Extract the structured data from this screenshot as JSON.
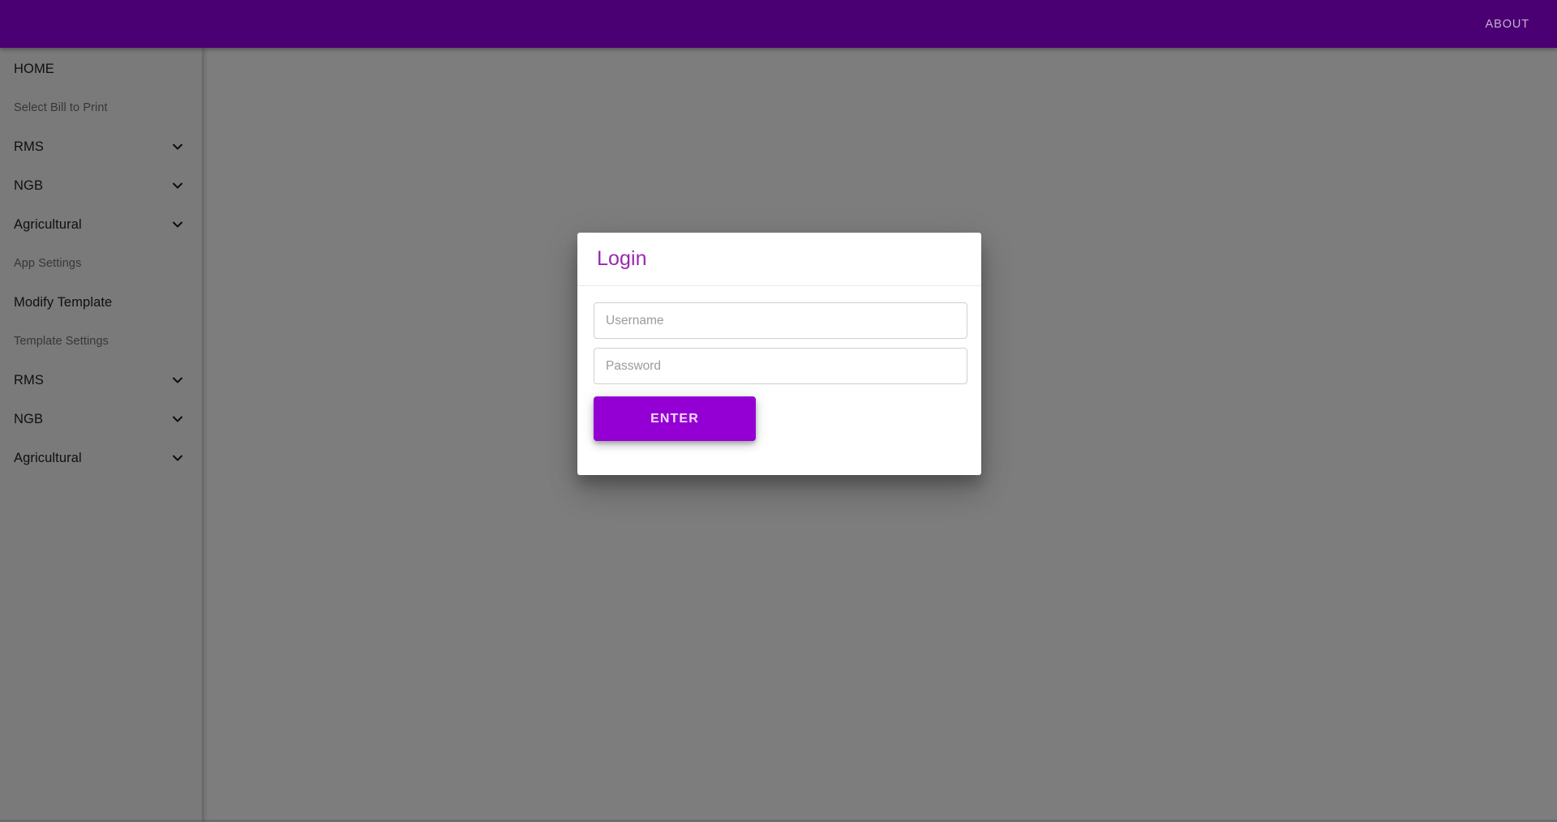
{
  "appbar": {
    "title": "",
    "action_label": "ABOUT",
    "background_color": "#4a0072",
    "action_color": "#c6aed4"
  },
  "sidebar": {
    "background_color": "#f4f4f4",
    "items": [
      {
        "label": "HOME",
        "type": "link",
        "icon": ""
      },
      {
        "label": "Select Bill to Print",
        "type": "section",
        "icon": ""
      },
      {
        "label": "RMS",
        "type": "expandable",
        "icon": "chevron-down-icon"
      },
      {
        "label": "NGB",
        "type": "expandable",
        "icon": "chevron-down-icon"
      },
      {
        "label": "Agricultural",
        "type": "expandable",
        "icon": "chevron-down-icon"
      },
      {
        "label": "App Settings",
        "type": "section",
        "icon": ""
      },
      {
        "label": "Modify Template",
        "type": "link",
        "icon": ""
      },
      {
        "label": "Template Settings",
        "type": "section",
        "icon": ""
      },
      {
        "label": "RMS",
        "type": "expandable",
        "icon": "chevron-down-icon"
      },
      {
        "label": "NGB",
        "type": "expandable",
        "icon": "chevron-down-icon"
      },
      {
        "label": "Agricultural",
        "type": "expandable",
        "icon": "chevron-down-icon"
      }
    ]
  },
  "login_dialog": {
    "title": "Login",
    "title_color": "#9c27b0",
    "username": {
      "placeholder": "Username",
      "value": ""
    },
    "password": {
      "placeholder": "Password",
      "value": ""
    },
    "submit_label": "ENTER",
    "submit_color": "#9400d3"
  }
}
